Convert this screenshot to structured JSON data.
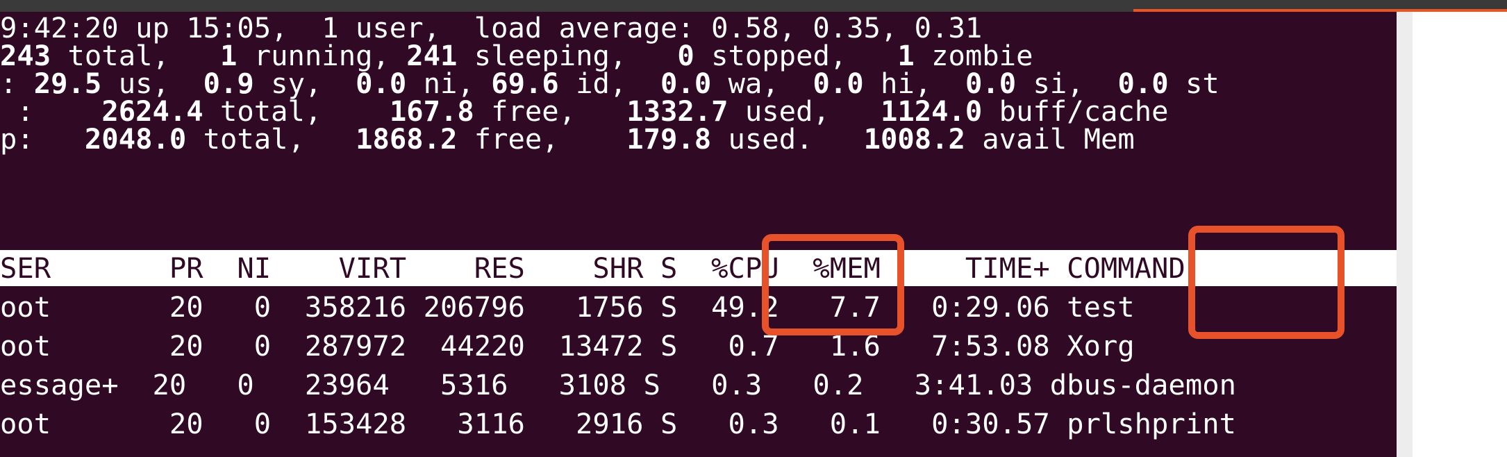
{
  "window": {
    "colors": {
      "terminal_background": "#300a24",
      "terminal_text": "#ffffff",
      "header_band": "#ffffff",
      "highlight": "#e8522b",
      "accent": "#e95420"
    }
  },
  "summary": {
    "uptime_line": "9:42:20 up 15:05,  1 user,  load average: 0.58, 0.35, 0.31",
    "tasks": {
      "prefix": "243",
      "t1": " total,   ",
      "running": "1",
      "t2": " running, ",
      "sleeping": "241",
      "t3": " sleeping,   ",
      "stopped": "0",
      "t4": " stopped,   ",
      "zombie": "1",
      "t5": " zombie"
    },
    "cpu": {
      "prefix": ": ",
      "us": "29.5",
      "t1": " us,  ",
      "sy": "0.9",
      "t2": " sy,  ",
      "ni": "0.0",
      "t3": " ni, ",
      "id": "69.6",
      "t4": " id,  ",
      "wa": "0.0",
      "t5": " wa,  ",
      "hi": "0.0",
      "t6": " hi,  ",
      "si": "0.0",
      "t7": " si,  ",
      "st": "0.0",
      "t8": " st"
    },
    "mem": {
      "prefix": " :    ",
      "total": "2624.4",
      "t1": " total,    ",
      "free": "167.8",
      "t2": " free,   ",
      "used": "1332.7",
      "t3": " used,   ",
      "buff_cache": "1124.0",
      "t4": " buff/cache"
    },
    "swap": {
      "prefix": "p:   ",
      "total": "2048.0",
      "t1": " total,   ",
      "free": "1868.2",
      "t2": " free,    ",
      "used": "179.8",
      "t3": " used.   ",
      "avail": "1008.2",
      "t4": " avail Mem"
    }
  },
  "process_table": {
    "header_line": "SER       PR  NI    VIRT    RES    SHR S  %CPU  %MEM     TIME+ COMMAND",
    "rows": [
      "oot       20   0  358216 206796   1756 S  49.2   7.7   0:29.06 test",
      "oot       20   0  287972  44220  13472 S   0.7   1.6   7:53.08 Xorg",
      "essage+  20   0   23964   5316   3108 S   0.3   0.2   3:41.03 dbus-daemon",
      "oot       20   0  153428   3116   2916 S   0.3   0.1   0:30.57 prlshprint"
    ]
  }
}
